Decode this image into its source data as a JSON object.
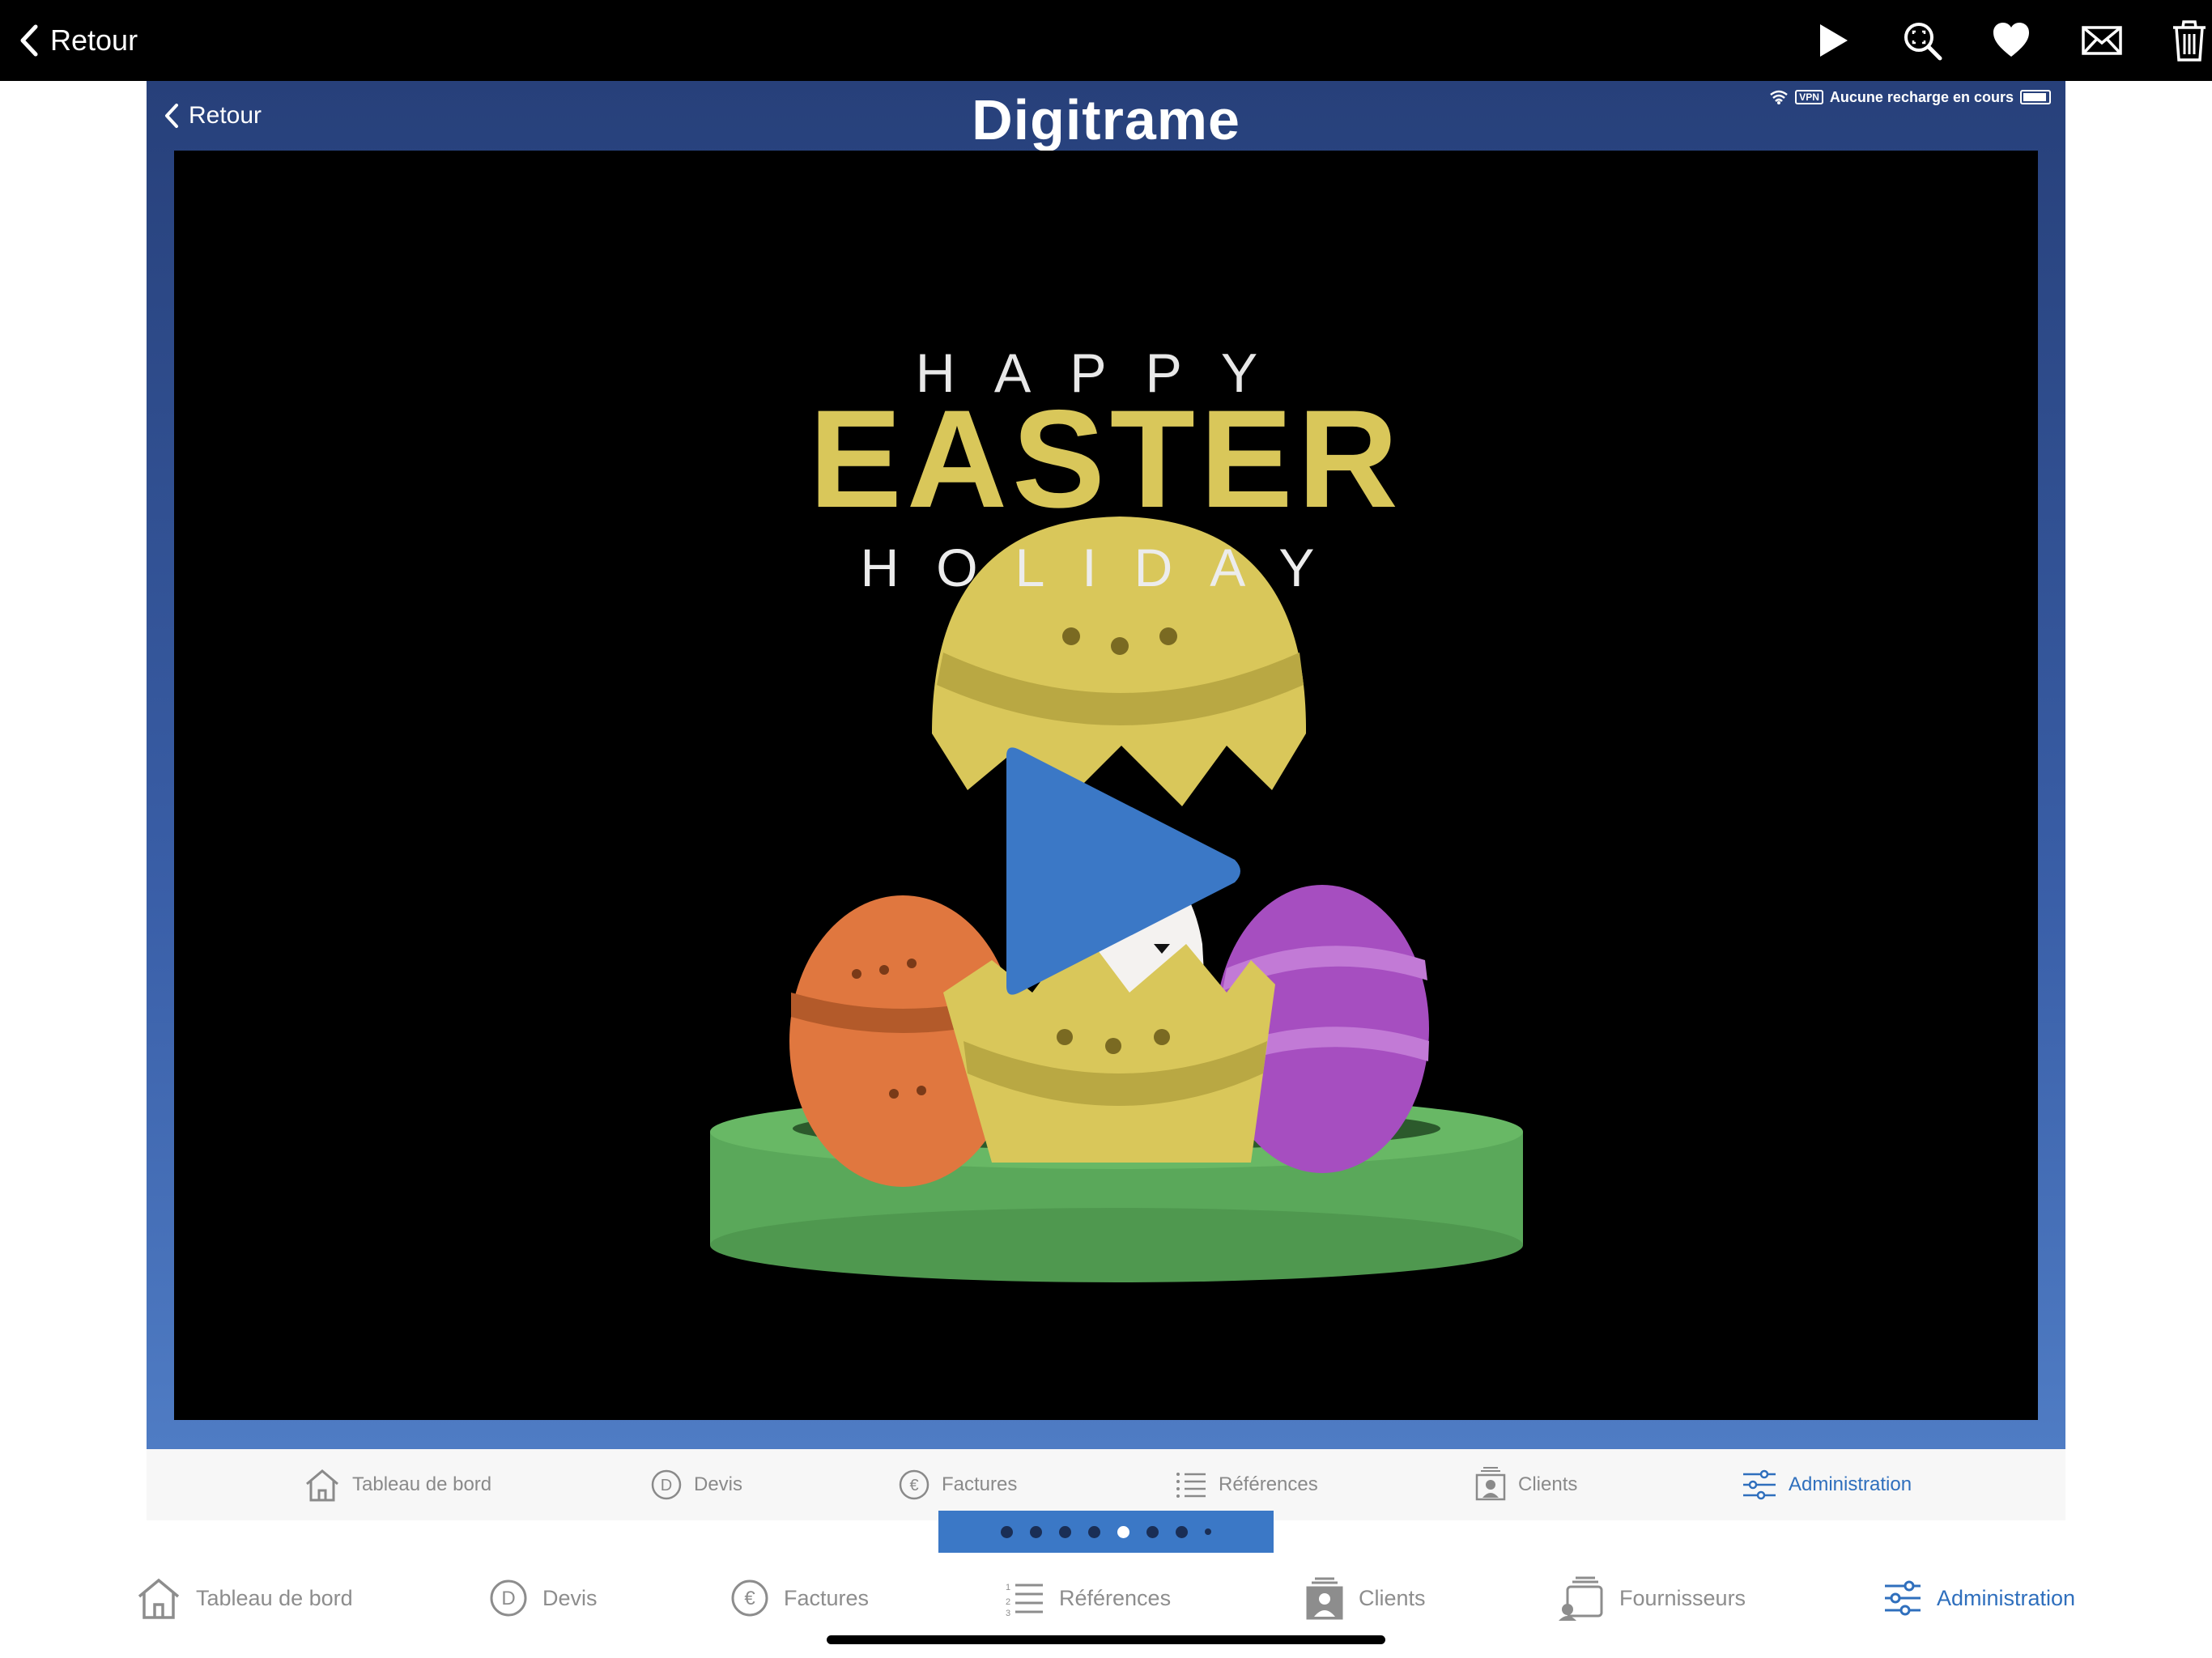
{
  "topbar": {
    "back_label": "Retour",
    "actions": [
      "play-icon",
      "zoom-icon",
      "heart-icon",
      "mail-icon",
      "trash-icon"
    ]
  },
  "screenshot": {
    "back_label": "Retour",
    "brand": "Digitrame",
    "status_vpn": "VPN",
    "status_text": "Aucune recharge en cours",
    "artwork": {
      "line1": "HAPPY",
      "line2": "EASTER",
      "line3": "HOLIDAY"
    },
    "tabs": [
      {
        "label": "Tableau de bord",
        "icon": "home-icon"
      },
      {
        "label": "Devis",
        "icon": "devis-icon"
      },
      {
        "label": "Factures",
        "icon": "euro-icon"
      },
      {
        "label": "Références",
        "icon": "list-icon"
      },
      {
        "label": "Clients",
        "icon": "clients-icon"
      },
      {
        "label": "Administration",
        "icon": "sliders-icon",
        "active": true
      }
    ]
  },
  "pager": {
    "count": 8,
    "active_index": 4
  },
  "tabbar": {
    "tabs": [
      {
        "label": "Tableau de bord",
        "icon": "home-icon"
      },
      {
        "label": "Devis",
        "icon": "devis-icon"
      },
      {
        "label": "Factures",
        "icon": "euro-icon"
      },
      {
        "label": "Références",
        "icon": "list-icon"
      },
      {
        "label": "Clients",
        "icon": "clients-icon"
      },
      {
        "label": "Fournisseurs",
        "icon": "suppliers-icon"
      },
      {
        "label": "Administration",
        "icon": "sliders-icon",
        "active": true
      }
    ]
  },
  "colors": {
    "accent": "#2f6fbd",
    "pager_bg": "#3b78c6",
    "egg_yellow": "#d9c75a",
    "egg_orange": "#e0773f",
    "egg_purple": "#a64ec0",
    "grass": "#5aa85a"
  }
}
